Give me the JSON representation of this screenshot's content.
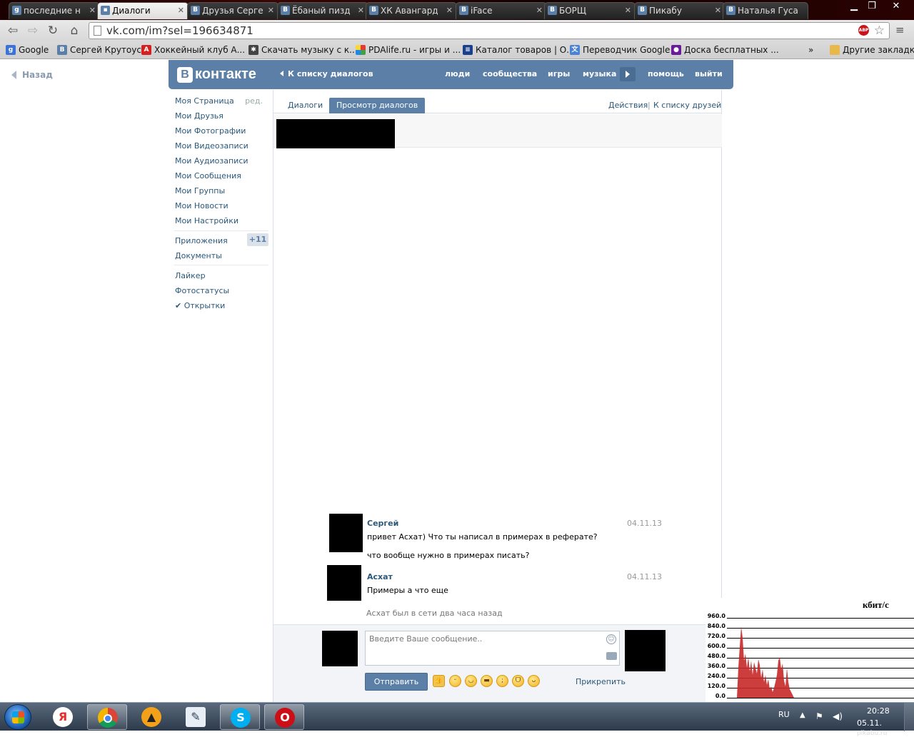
{
  "browser": {
    "tabs": [
      {
        "label": "последние н",
        "icon": "google-icon",
        "active": false
      },
      {
        "label": "Диалоги",
        "icon": "vk-message-icon",
        "active": true
      },
      {
        "label": "Друзья Серге",
        "icon": "vk-icon",
        "active": false
      },
      {
        "label": "Ёбаный пизд",
        "icon": "vk-icon",
        "active": false
      },
      {
        "label": "ХК Авангард",
        "icon": "vk-icon",
        "active": false
      },
      {
        "label": "iFace",
        "icon": "vk-icon",
        "active": false
      },
      {
        "label": "БОРЩ",
        "icon": "vk-icon",
        "active": false
      },
      {
        "label": "Пикабу",
        "icon": "vk-icon",
        "active": false
      },
      {
        "label": "Наталья Гуса",
        "icon": "vk-icon",
        "active": false
      }
    ],
    "url": "vk.com/im?sel=196634871",
    "bookmarks": [
      {
        "label": "Google",
        "icon": "google-icon"
      },
      {
        "label": "Сергей Крутоус",
        "icon": "vk-icon"
      },
      {
        "label": "Хоккейный клуб А...",
        "icon": "hockey-icon"
      },
      {
        "label": "Скачать музыку с к...",
        "icon": "bug-icon"
      },
      {
        "label": "PDAlife.ru - игры и ...",
        "icon": "pdalife-icon"
      },
      {
        "label": "Каталог товаров | О...",
        "icon": "catalog-icon"
      },
      {
        "label": "Переводчик Google",
        "icon": "translate-icon"
      },
      {
        "label": "Доска бесплатных ...",
        "icon": "board-icon"
      }
    ],
    "more_bookmarks": "»",
    "other_bookmarks": "Другие закладки"
  },
  "page": {
    "back_label": "Назад",
    "logo_text": "контакте",
    "logo_letter": "В",
    "to_dialogs": "К списку диалогов",
    "topnav": [
      "люди",
      "сообщества",
      "игры",
      "музыка",
      "помощь",
      "выйти"
    ]
  },
  "sidebar": {
    "edit_label": "ред.",
    "items": [
      "Моя Страница",
      "Мои Друзья",
      "Мои Фотографии",
      "Мои Видеозаписи",
      "Мои Аудиозаписи",
      "Мои Сообщения",
      "Мои Группы",
      "Мои Новости",
      "Мои Настройки"
    ],
    "apps": "Приложения",
    "apps_badge": "+11",
    "documents": "Документы",
    "extras": [
      "Лайкер",
      "Фотостатусы",
      "✔ Открытки"
    ]
  },
  "dialog": {
    "tabs": [
      "Диалоги",
      "Просмотр диалогов"
    ],
    "actions": "Действия",
    "separator": "|",
    "to_friends": "К списку друзей",
    "messages": [
      {
        "author": "Сергей",
        "date": "04.11.13",
        "lines": [
          "привет Асхат) Что ты написал в примерах в реферате?",
          "что вообще нужно в примерах писать?"
        ]
      },
      {
        "author": "Асхат",
        "date": "04.11.13",
        "lines": [
          "Примеры а что еще"
        ]
      }
    ],
    "status": "Асхат был в сети два часа назад",
    "input_placeholder": "Введите Ваше сообщение..",
    "send": "Отправить",
    "attach": "Прикрепить"
  },
  "meter": {
    "title": "кбит/с",
    "ticks": [
      "960.0",
      "840.0",
      "720.0",
      "600.0",
      "480.0",
      "360.0",
      "240.0",
      "120.0",
      "0.0"
    ]
  },
  "taskbar": {
    "apps": [
      "yandex-browser-icon",
      "chrome-icon",
      "aimp-icon",
      "notepad-icon",
      "skype-icon",
      "opera-icon"
    ],
    "lang": "RU",
    "time": "20:28",
    "date": "05.11.",
    "watermark": "pikabu.ru"
  },
  "colors": {
    "vk_blue": "#5b7fa6",
    "link": "#2b587a",
    "meter_bar": "#c62828"
  }
}
